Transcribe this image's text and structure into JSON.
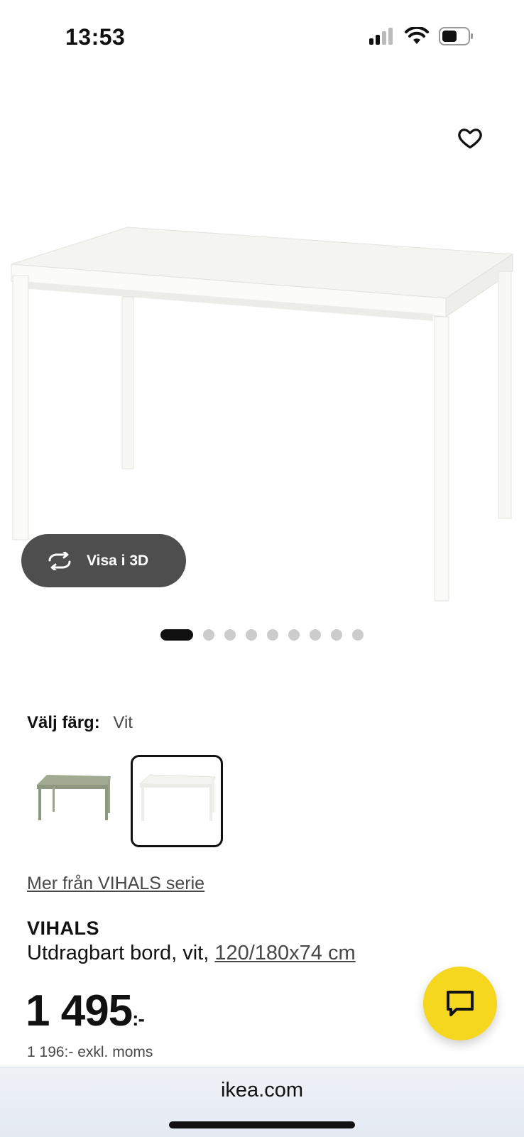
{
  "status": {
    "time": "13:53",
    "icons": [
      "signal-icon",
      "wifi-icon",
      "battery-icon"
    ]
  },
  "hero": {
    "button_3d_label": "Visa i 3D",
    "image_count": 9,
    "active_image": 1
  },
  "color_picker": {
    "label": "Välj färg:",
    "selected": "Vit",
    "options": [
      {
        "name": "green-table-swatch",
        "color": "#a2ab92"
      },
      {
        "name": "white-table-swatch",
        "color": "#f5f5f2"
      }
    ]
  },
  "series_link": "Mer från VIHALS serie",
  "product": {
    "name": "VIHALS",
    "description": "Utdragbart bord, vit, ",
    "dimensions": "120/180x74 cm",
    "price": "1 495",
    "price_suffix": ":-",
    "price_excl": "1 196:- exkl. moms"
  },
  "browser": {
    "url": "ikea.com"
  },
  "colors": {
    "accent_yellow": "#f6d71f",
    "button_dark": "#4e4e4e"
  }
}
